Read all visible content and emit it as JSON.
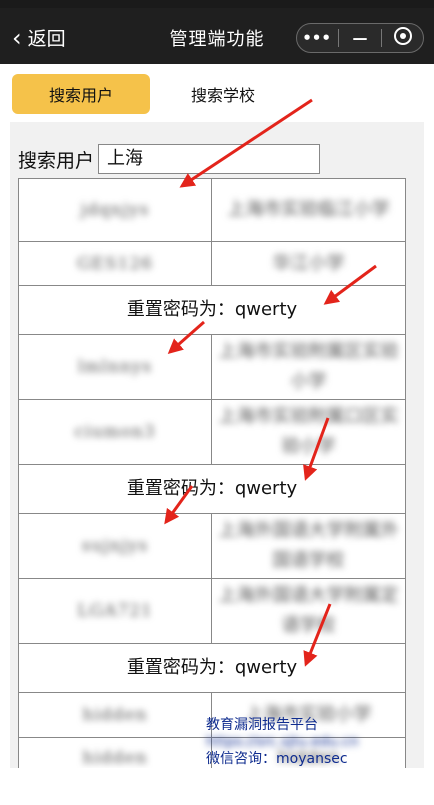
{
  "header": {
    "back_label": "返回",
    "title": "管理端功能",
    "capsule": {
      "more_label": "•••",
      "minimize_label": "—"
    }
  },
  "tabs": [
    {
      "label": "搜索用户",
      "active": true
    },
    {
      "label": "搜索学校",
      "active": false
    }
  ],
  "search": {
    "label": "搜索用户",
    "value": "上海"
  },
  "rows": [
    {
      "type": "user",
      "username": "jdqnjys",
      "school": "上海市实验临江小学"
    },
    {
      "type": "user",
      "username": "GES126",
      "school": "华江小学"
    },
    {
      "type": "reset",
      "text": "重置密码为：qwerty"
    },
    {
      "type": "user",
      "username": "lmlnnys",
      "school": "上海市实验附属区实验小学"
    },
    {
      "type": "user",
      "username": "ciumon3",
      "school": "上海市实验附属口区实验小学"
    },
    {
      "type": "reset",
      "text": "重置密码为：qwerty"
    },
    {
      "type": "user",
      "username": "sujnjys",
      "school": "上海外国语大学附属外国语学校"
    },
    {
      "type": "user",
      "username": "LGA721",
      "school": "上海外国语大学附属定语学校"
    },
    {
      "type": "reset",
      "text": "重置密码为：qwerty"
    },
    {
      "type": "user",
      "username": "hidden",
      "school": "上海市实验小学"
    },
    {
      "type": "user",
      "username": "hidden",
      "school": "hidden"
    }
  ],
  "watermark": {
    "line1": "教育漏洞报告平台",
    "line2": "https://src.sjtu.edu.cn",
    "line3": "微信咨询：moyansec"
  },
  "colors": {
    "topbar": "#1f1f1f",
    "active_tab": "#f5c24a",
    "annotation_arrow": "#e3241b",
    "watermark_text": "#0f2c8f"
  },
  "icons": {
    "back": "chevron-left-icon",
    "more": "more-dots-icon",
    "minimize": "minimize-icon",
    "close": "target-close-icon"
  }
}
